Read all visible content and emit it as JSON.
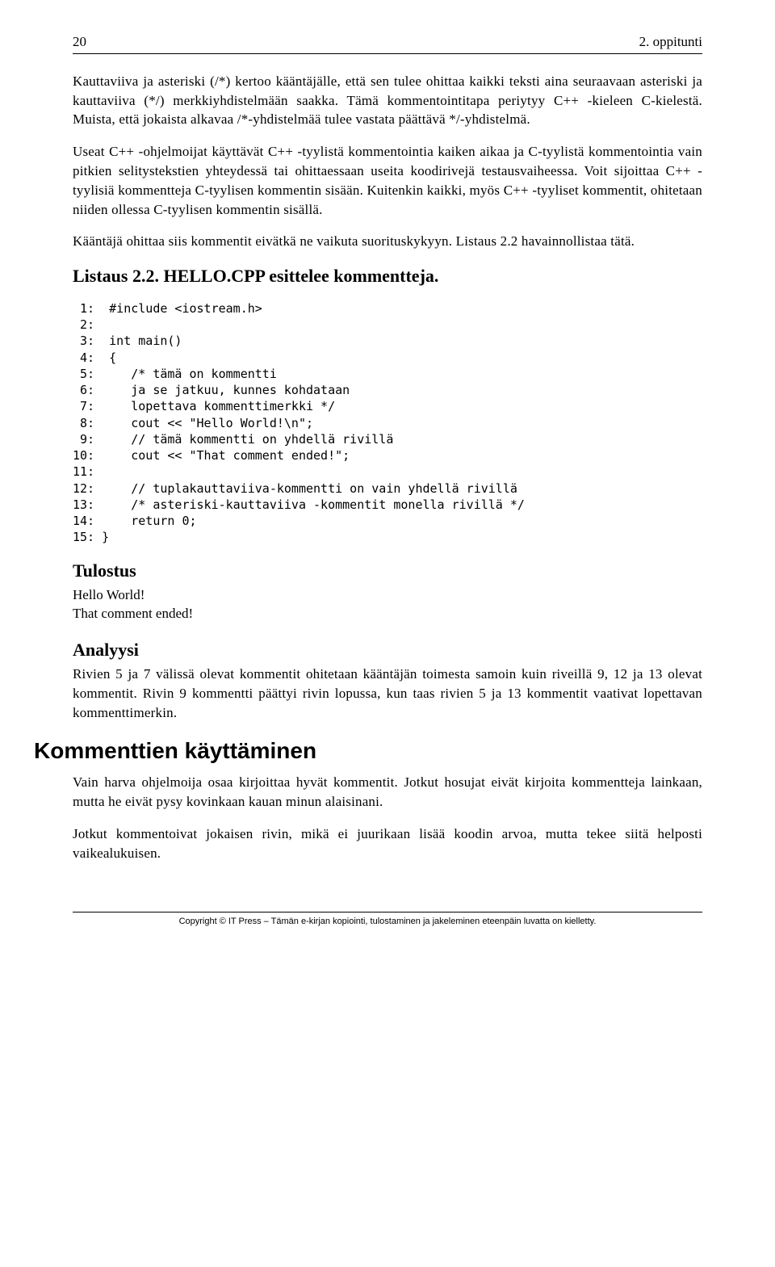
{
  "header": {
    "page_number": "20",
    "title": "2. oppitunti"
  },
  "paragraphs": {
    "p1": "Kauttaviiva ja asteriski (/*) kertoo kääntäjälle, että sen tulee ohittaa kaikki teksti aina seuraavaan asteriski ja kauttaviiva (*/) merkkiyhdistelmään saakka. Tämä kommentointitapa periytyy C++ -kieleen C-kielestä. Muista, että jokaista alkavaa /*-yhdistelmää tulee vastata päättävä */-yhdistelmä.",
    "p2": "Useat C++ -ohjelmoijat käyttävät C++ -tyylistä kommentointia kaiken aikaa ja C-tyylistä kommentointia vain pitkien selitystekstien yhteydessä tai ohittaessaan useita koodirivejä testausvaiheessa. Voit sijoittaa C++ -tyylisiä kommentteja C-tyylisen kommentin sisään. Kuitenkin kaikki, myös C++ -tyyliset kommentit, ohitetaan niiden ollessa C-tyylisen kommentin sisällä.",
    "p3": "Kääntäjä ohittaa siis kommentit eivätkä ne vaikuta suorituskykyyn. Listaus 2.2 havainnollistaa tätä.",
    "p4": "Rivien 5 ja 7 välissä olevat kommentit ohitetaan kääntäjän toimesta samoin kuin riveillä 9, 12 ja 13 olevat kommentit. Rivin 9 kommentti päättyi rivin lopussa, kun taas rivien 5 ja 13 kommentit vaativat lopettavan kommenttimerkin.",
    "p5": "Vain harva ohjelmoija osaa kirjoittaa hyvät kommentit. Jotkut hosujat eivät kirjoita kommentteja lainkaan, mutta he eivät pysy kovinkaan kauan minun alaisinani.",
    "p6": "Jotkut kommentoivat jokaisen rivin, mikä ei juurikaan lisää koodin arvoa, mutta tekee siitä helposti vaikealukuisen."
  },
  "listing": {
    "title": "Listaus 2.2. HELLO.CPP esittelee kommentteja.",
    "code": " 1:  #include <iostream.h>\n 2:\n 3:  int main()\n 4:  {\n 5:     /* tämä on kommentti\n 6:     ja se jatkuu, kunnes kohdataan\n 7:     lopettava kommenttimerkki */\n 8:     cout << \"Hello World!\\n\";\n 9:     // tämä kommentti on yhdellä rivillä\n10:     cout << \"That comment ended!\";\n11:\n12:     // tuplakauttaviiva-kommentti on vain yhdellä rivillä\n13:     /* asteriski-kauttaviiva -kommentit monella rivillä */\n14:     return 0;\n15: }"
  },
  "output": {
    "title": "Tulostus",
    "line1": "Hello World!",
    "line2": "That comment ended!"
  },
  "analysis": {
    "title": "Analyysi"
  },
  "section": {
    "title": "Kommenttien käyttäminen"
  },
  "footer": "Copyright © IT Press – Tämän e-kirjan kopiointi, tulostaminen ja jakeleminen eteenpäin luvatta on kielletty."
}
